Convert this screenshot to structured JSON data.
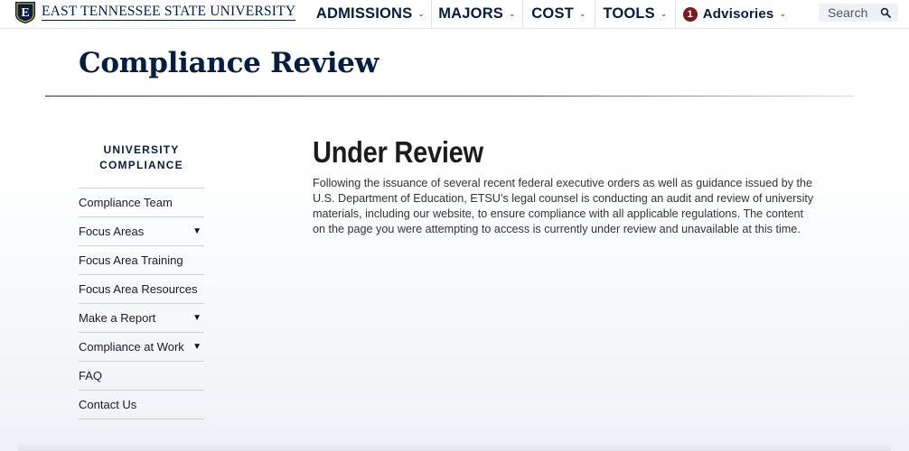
{
  "header": {
    "logo_letter": "E",
    "university_name": "EAST TENNESSEE STATE UNIVERSITY",
    "nav": [
      {
        "label": "ADMISSIONS",
        "icon": "chevron-down-icon"
      },
      {
        "label": "MAJORS",
        "icon": "chevron-down-icon"
      },
      {
        "label": "COST",
        "icon": "chevron-down-icon"
      },
      {
        "label": "TOOLS",
        "icon": "chevron-down-icon"
      }
    ],
    "advisories": {
      "count": "1",
      "label": "Advisories",
      "badge_color": "#7a1a1a"
    },
    "search": {
      "placeholder": "Search",
      "icon": "search-icon"
    }
  },
  "page": {
    "title": "Compliance Review"
  },
  "sidebar": {
    "heading_line1": "UNIVERSITY",
    "heading_line2": "COMPLIANCE",
    "items": [
      {
        "label": "Compliance Team",
        "has_submenu": false
      },
      {
        "label": "Focus Areas",
        "has_submenu": true
      },
      {
        "label": "Focus Area Training",
        "has_submenu": false
      },
      {
        "label": "Focus Area Resources",
        "has_submenu": false
      },
      {
        "label": "Make a Report",
        "has_submenu": true
      },
      {
        "label": "Compliance at Work",
        "has_submenu": true
      },
      {
        "label": "FAQ",
        "has_submenu": false
      },
      {
        "label": "Contact Us",
        "has_submenu": false
      }
    ],
    "caret_glyph": "▼"
  },
  "main": {
    "heading": "Under Review",
    "body": "Following the issuance of several recent federal executive orders as well as guidance issued by the U.S. Department of Education, ETSU’s legal counsel is conducting an audit and review of university materials, including our website, to ensure compliance with all applicable regulations. The content on the page you were attempting to access is currently under review and unavailable at this time."
  },
  "colors": {
    "brand_navy": "#041e42",
    "brand_gold": "#ffc72c"
  }
}
